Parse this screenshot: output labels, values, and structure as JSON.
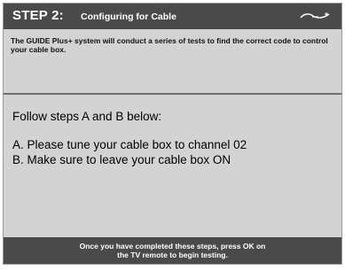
{
  "header": {
    "step_label": "STEP 2:",
    "title": "Configuring for Cable",
    "logo_icon": "guide-plus-logo"
  },
  "intro": {
    "text": "The GUIDE Plus+ system will conduct a series of tests to find the correct code to control your cable box."
  },
  "main": {
    "heading": "Follow steps A and B below:",
    "steps": [
      "A. Please tune your cable box to channel 02",
      "B. Make sure to leave your cable box ON"
    ]
  },
  "footer": {
    "line1": "Once you have completed these steps, press OK on",
    "line2": "the TV remote to begin testing."
  },
  "colors": {
    "header_bg": "#4a4a4a",
    "panel_bg": "#d3d3d3",
    "text_dark": "#000000",
    "text_light": "#ffffff"
  }
}
